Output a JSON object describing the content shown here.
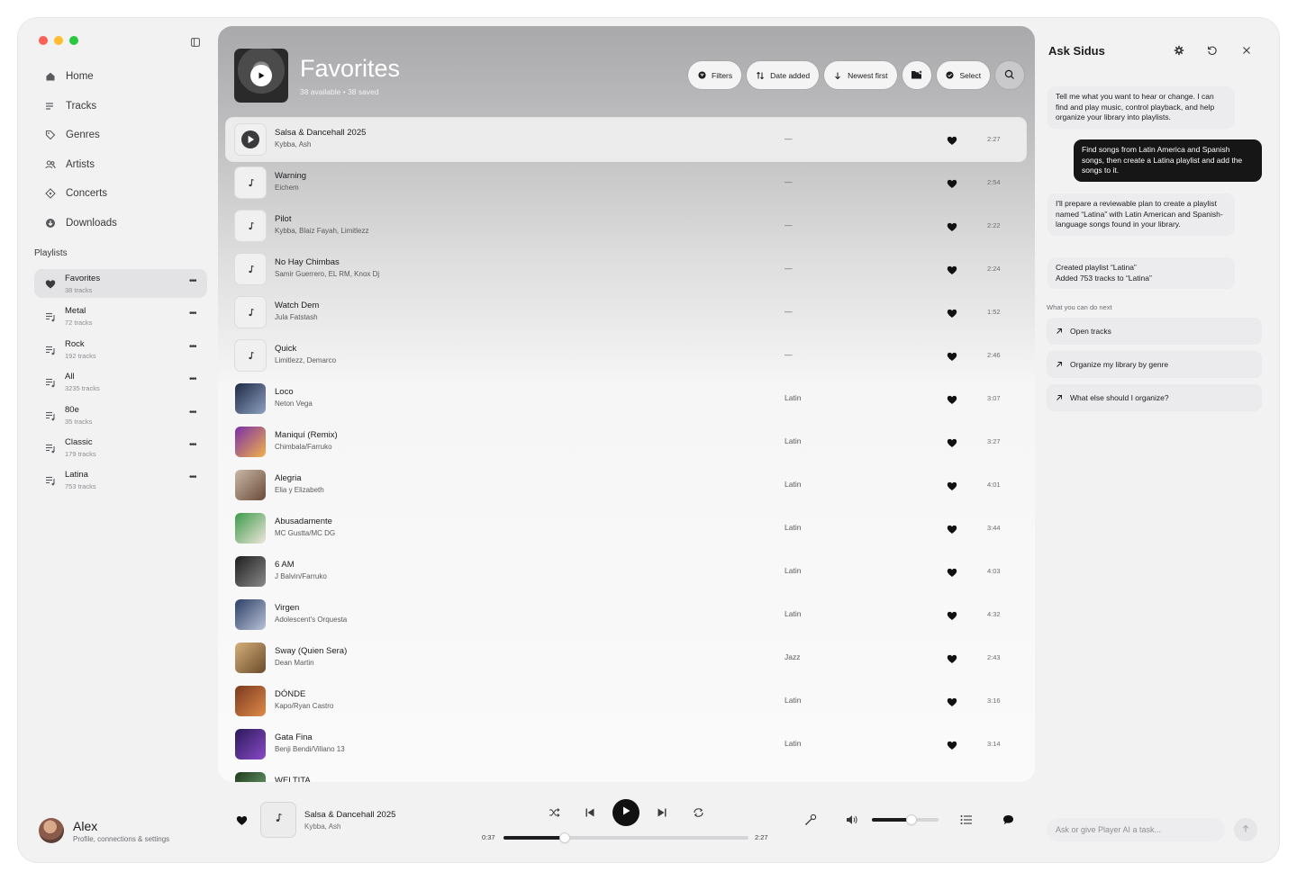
{
  "colors": {
    "accent": "#111111",
    "user_bubble": "#161616",
    "window_bg": "#f2f2f3"
  },
  "sidebar": {
    "nav": [
      {
        "label": "Home",
        "icon": "home-icon"
      },
      {
        "label": "Tracks",
        "icon": "tracks-icon"
      },
      {
        "label": "Genres",
        "icon": "tag-icon"
      },
      {
        "label": "Artists",
        "icon": "people-icon"
      },
      {
        "label": "Concerts",
        "icon": "diamond-icon"
      },
      {
        "label": "Downloads",
        "icon": "download-icon"
      }
    ],
    "playlists_title": "Playlists",
    "playlists": [
      {
        "name": "Favorites",
        "count": "38 tracks",
        "icon": "heart-icon",
        "active": true
      },
      {
        "name": "Metal",
        "count": "72 tracks",
        "icon": "playlist-icon"
      },
      {
        "name": "Rock",
        "count": "192 tracks",
        "icon": "playlist-icon"
      },
      {
        "name": "All",
        "count": "3235 tracks",
        "icon": "playlist-icon"
      },
      {
        "name": "80e",
        "count": "35 tracks",
        "icon": "playlist-icon"
      },
      {
        "name": "Classic",
        "count": "179 tracks",
        "icon": "playlist-icon"
      },
      {
        "name": "Latina",
        "count": "753 tracks",
        "icon": "playlist-icon"
      }
    ],
    "profile": {
      "name": "Alex",
      "sub": "Profile, connections & settings"
    }
  },
  "main": {
    "title": "Favorites",
    "subtitle": "38 available • 38 saved",
    "toolbar": {
      "filters": "Filters",
      "date_added": "Date added",
      "newest_first": "Newest first",
      "select": "Select"
    },
    "tracks": [
      {
        "title": "Salsa & Dancehall 2025",
        "artist": "Kybba, Ash",
        "genre": "—",
        "duration": "2:27",
        "art": "play",
        "playing": true
      },
      {
        "title": "Warning",
        "artist": "Eichem",
        "genre": "—",
        "duration": "2:54",
        "art": "note"
      },
      {
        "title": "Pilot",
        "artist": "Kybba, Blaiz Fayah, Limitlezz",
        "genre": "—",
        "duration": "2:22",
        "art": "note"
      },
      {
        "title": "No Hay Chimbas",
        "artist": "Samir Guerrero, EL RM, Knox Dj",
        "genre": "—",
        "duration": "2:24",
        "art": "note"
      },
      {
        "title": "Watch Dem",
        "artist": "Jula Fatstash",
        "genre": "—",
        "duration": "1:52",
        "art": "note"
      },
      {
        "title": "Quick",
        "artist": "Limitlezz, Demarco",
        "genre": "—",
        "duration": "2:46",
        "art": "note"
      },
      {
        "title": "Loco",
        "artist": "Neton Vega",
        "genre": "Latin",
        "duration": "3:07",
        "art": "cover",
        "c1": "#1d2a44",
        "c2": "#8fa1c2"
      },
      {
        "title": "Maniquí (Remix)",
        "artist": "Chimbala/Farruko",
        "genre": "Latin",
        "duration": "3:27",
        "art": "cover",
        "c1": "#7a2fa8",
        "c2": "#f2b24a"
      },
      {
        "title": "Alegria",
        "artist": "Elia y Elizabeth",
        "genre": "Latin",
        "duration": "4:01",
        "art": "cover",
        "c1": "#c9b8a6",
        "c2": "#6b4a3a"
      },
      {
        "title": "Abusadamente",
        "artist": "MC Gustta/MC DG",
        "genre": "Latin",
        "duration": "3:44",
        "art": "cover",
        "c1": "#3c9a4a",
        "c2": "#f0e6dc"
      },
      {
        "title": "6 AM",
        "artist": "J Balvin/Farruko",
        "genre": "Latin",
        "duration": "4:03",
        "art": "cover",
        "c1": "#1e1e1e",
        "c2": "#8a8a8a"
      },
      {
        "title": "Virgen",
        "artist": "Adolescent's Orquesta",
        "genre": "Latin",
        "duration": "4:32",
        "art": "cover",
        "c1": "#2d3f66",
        "c2": "#b9c3d8"
      },
      {
        "title": "Sway (Quien Sera)",
        "artist": "Dean Martin",
        "genre": "Jazz",
        "duration": "2:43",
        "art": "cover",
        "c1": "#d6b07a",
        "c2": "#6a4a2a"
      },
      {
        "title": "DÓNDE",
        "artist": "Kapo/Ryan Castro",
        "genre": "Latin",
        "duration": "3:16",
        "art": "cover",
        "c1": "#7a3a1e",
        "c2": "#e08a4a"
      },
      {
        "title": "Gata Fina",
        "artist": "Benji Bendi/Villano 13",
        "genre": "Latin",
        "duration": "3:14",
        "art": "cover",
        "c1": "#2a1a5a",
        "c2": "#8a4ac8"
      },
      {
        "title": "WELTITA",
        "artist": "",
        "genre": "",
        "duration": "",
        "art": "cover",
        "c1": "#1e3a1e",
        "c2": "#7ab07a",
        "cut": true
      }
    ]
  },
  "player": {
    "title": "Salsa & Dancehall 2025",
    "artist": "Kybba, Ash",
    "elapsed": "0:37",
    "total": "2:27",
    "progress": 0.25,
    "volume": 0.6
  },
  "assistant": {
    "title": "Ask Sidus",
    "messages": [
      {
        "role": "ai",
        "text": "Tell me what you want to hear or change. I can find and play music, control playback, and help organize your library into playlists."
      },
      {
        "role": "user",
        "text": "Find songs from Latin America and Spanish songs, then create a Latina playlist and add the songs to it."
      },
      {
        "role": "ai",
        "text": "I'll prepare a reviewable plan to create a playlist named “Latina” with Latin American and Spanish-language songs found in your library."
      },
      {
        "role": "ai",
        "text": "Created playlist “Latina”\nAdded 753 tracks to “Latina”"
      }
    ],
    "next_title": "What you can do next",
    "suggestions": [
      "Open tracks",
      "Organize my library by genre",
      "What else should I organize?"
    ],
    "input_placeholder": "Ask or give Player AI a task..."
  }
}
